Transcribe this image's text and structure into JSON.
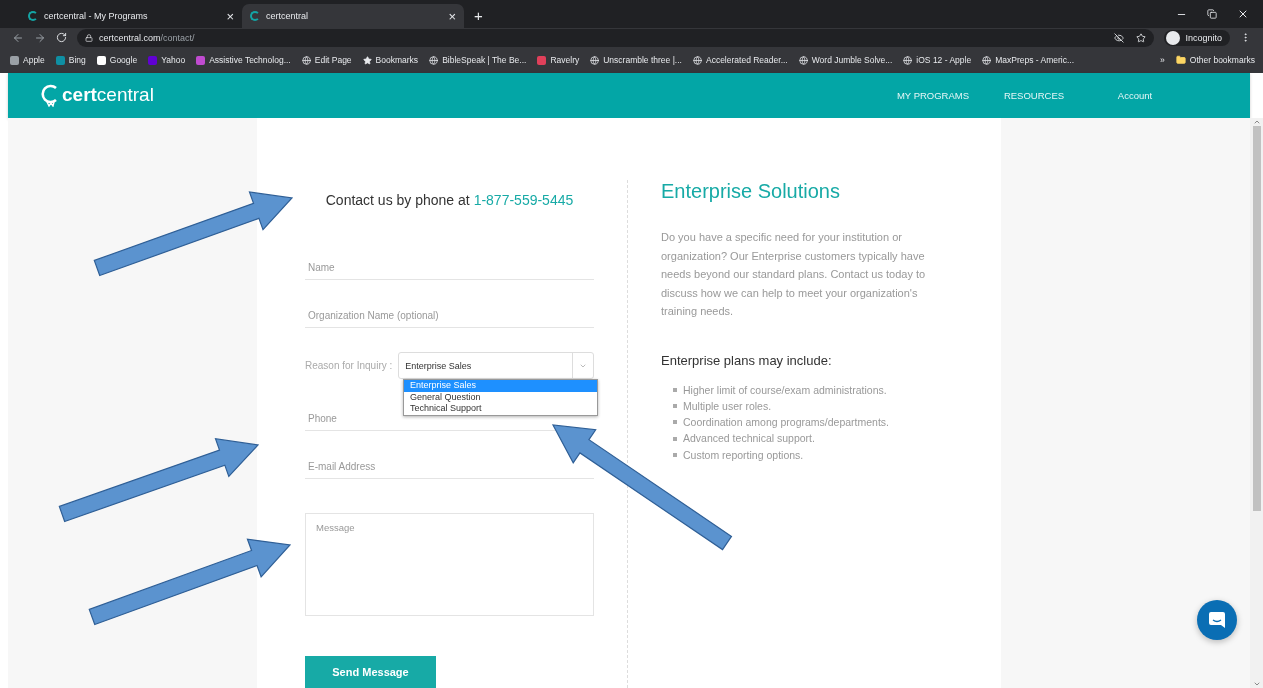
{
  "browser": {
    "tabs": [
      {
        "label": "certcentral - My Programs",
        "selected": false
      },
      {
        "label": "certcentral",
        "selected": true
      }
    ],
    "close_glyph": "×",
    "new_tab_glyph": "+",
    "address": {
      "host": "certcentral.com",
      "path": "/contact/"
    },
    "profile": "Incognito",
    "bookmarks": [
      "Apple",
      "Bing",
      "Google",
      "Yahoo",
      "Assistive Technolog...",
      "Edit Page",
      "Bookmarks",
      "BibleSpeak | The Be...",
      "Ravelry",
      "Unscramble three |...",
      "Accelerated Reader...",
      "Word Jumble Solve...",
      "iOS 12 - Apple",
      "MaxPreps - Americ..."
    ],
    "more_bookmarks": "»",
    "other_bookmarks": "Other bookmarks"
  },
  "site": {
    "logo_bold": "cert",
    "logo_light": "central",
    "nav": [
      "MY PROGRAMS",
      "RESOURCES",
      "Account"
    ]
  },
  "contact": {
    "phone_prefix": "Contact us by phone at",
    "phone": "1-877-559-5445",
    "fields": [
      {
        "kind": "line",
        "placeholder": "Name"
      },
      {
        "kind": "line",
        "placeholder": "Organization Name (optional)"
      },
      {
        "kind": "select",
        "label": "Reason for Inquiry :",
        "value": "Enterprise Sales",
        "expanded": true,
        "options": [
          {
            "label": "Enterprise Sales",
            "selected": true
          },
          {
            "label": "General Question",
            "selected": false
          },
          {
            "label": "Technical Support",
            "selected": false
          }
        ]
      },
      {
        "kind": "line",
        "placeholder": "Phone"
      },
      {
        "kind": "line",
        "placeholder": "E-mail Address"
      },
      {
        "kind": "textarea",
        "placeholder": "Message"
      }
    ],
    "submit": "Send Message"
  },
  "enterprise": {
    "title": "Enterprise Solutions",
    "intro": "Do you have a specific need for your institution or organization? Our Enterprise customers typically have needs beyond our standard plans. Contact us today to discuss how we can help to meet your organization's training needs.",
    "subtitle": "Enterprise plans may include:",
    "items": [
      "Higher limit of course/exam administrations.",
      "Multiple user roles.",
      "Coordination among programs/departments.",
      "Advanced technical support.",
      "Custom reporting options."
    ]
  }
}
